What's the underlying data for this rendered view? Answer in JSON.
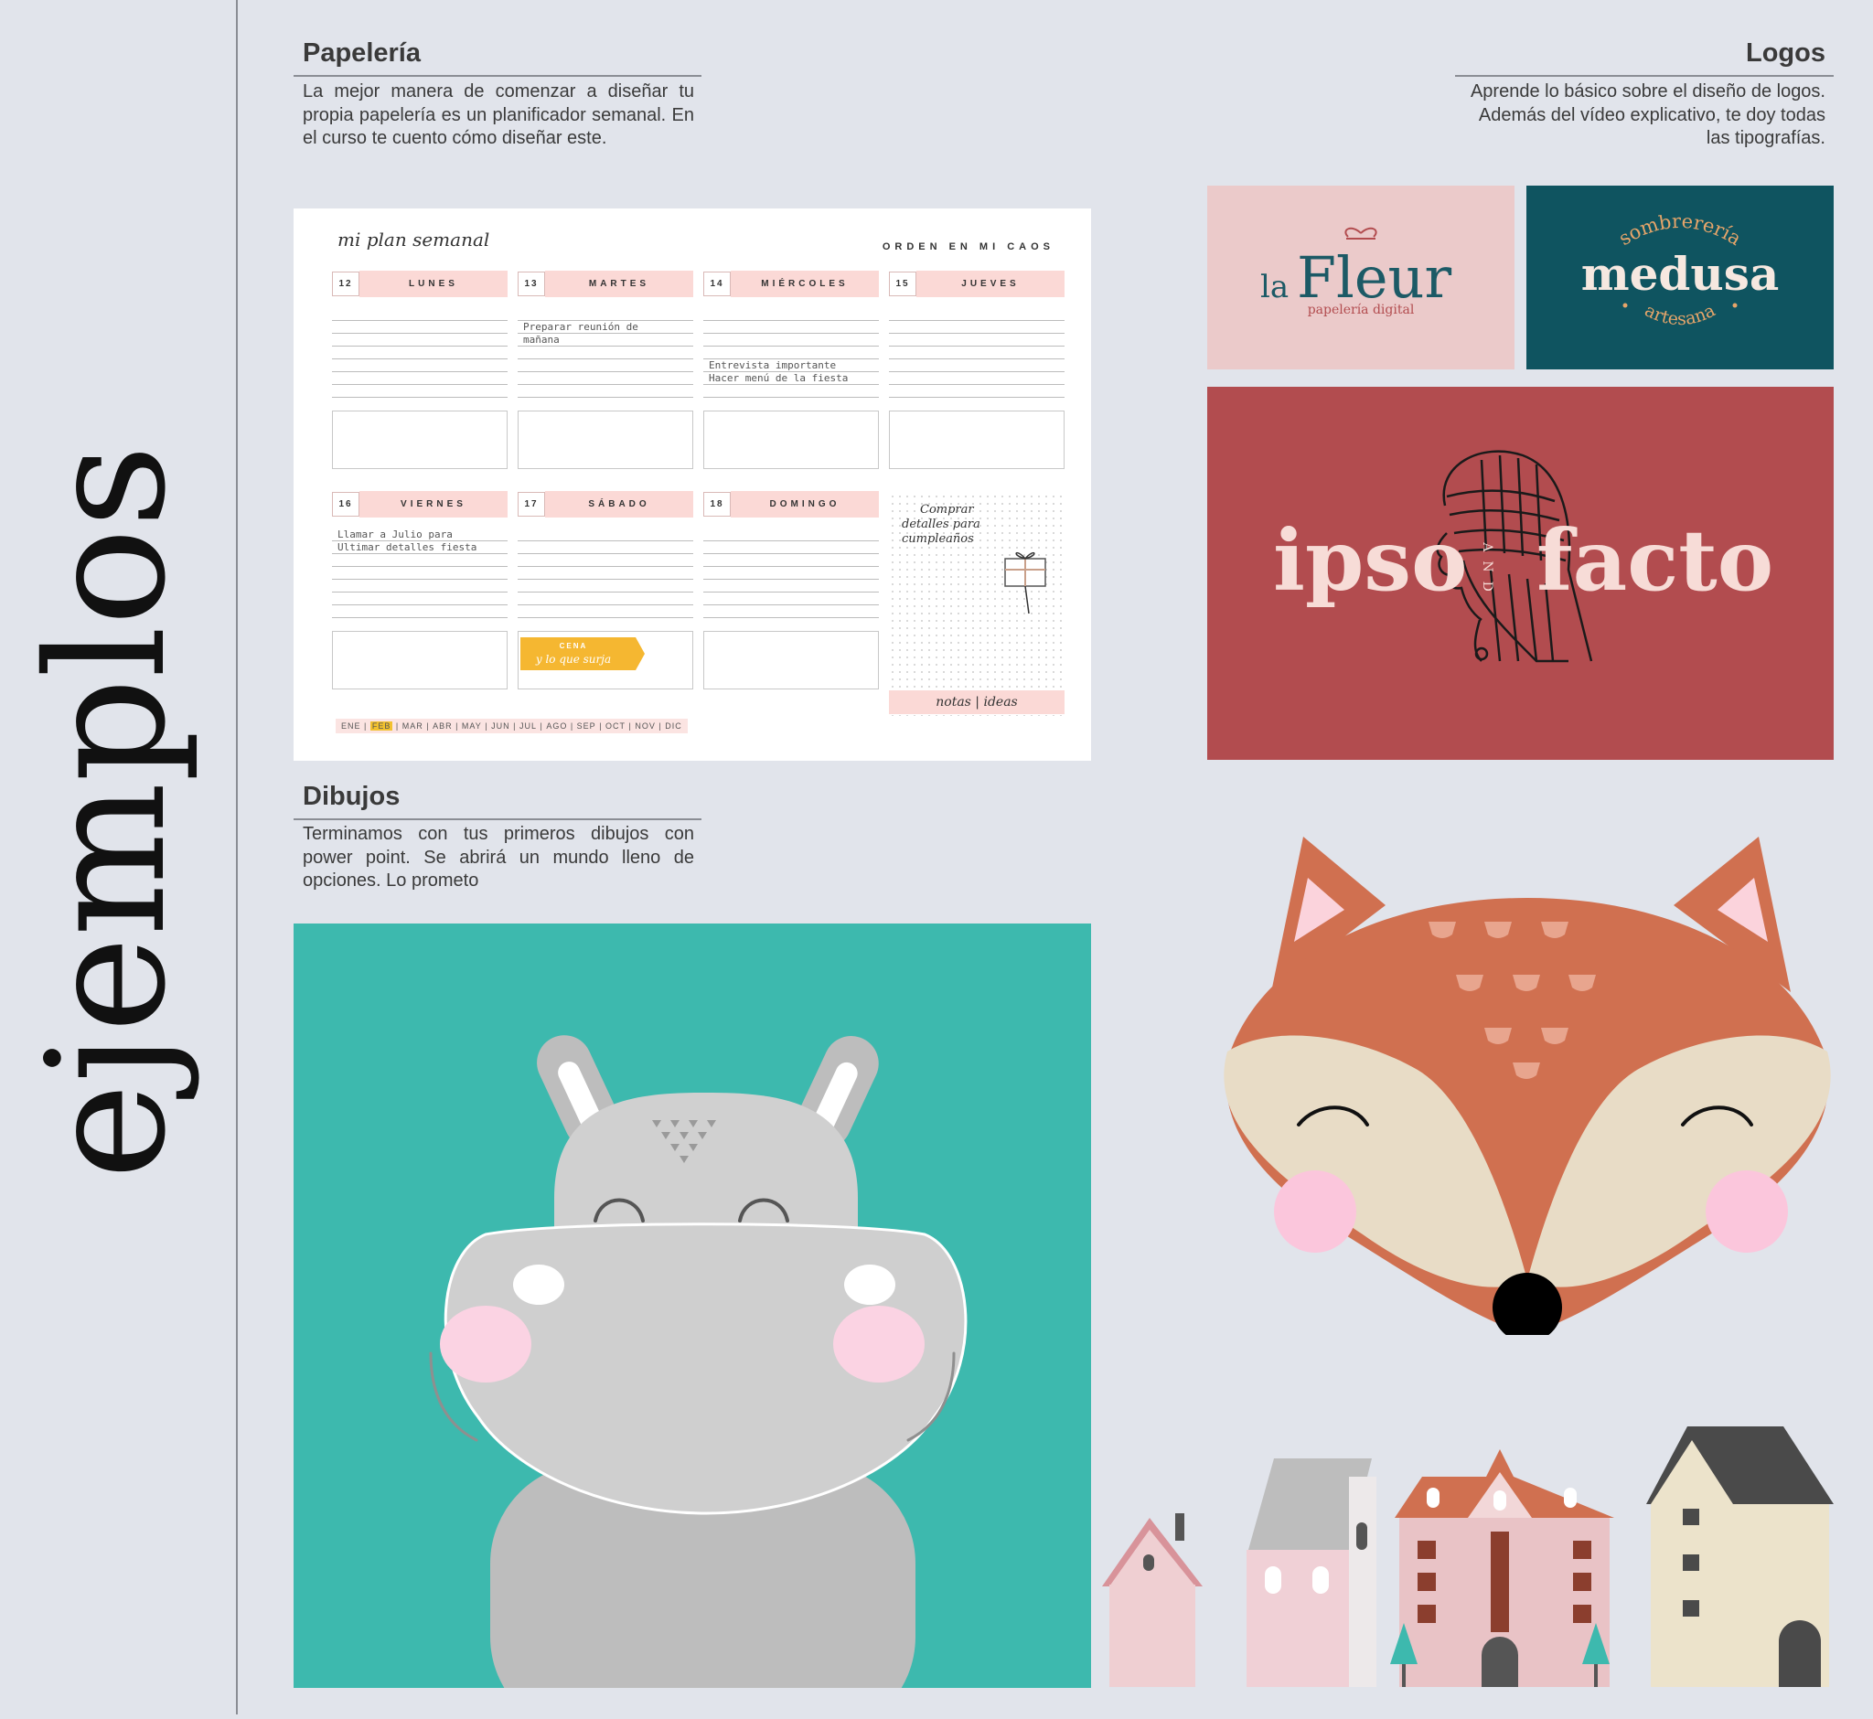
{
  "sidebar": {
    "title": "ejemplos"
  },
  "papeleria": {
    "title": "Papelería",
    "text": "La mejor manera de comenzar a diseñar tu propia papelería es un planificador semanal. En el curso te cuento cómo diseñar este."
  },
  "logos": {
    "title": "Logos",
    "text": "Aprende lo básico sobre el diseño de logos. Además del vídeo explicativo, te doy todas las tipografías."
  },
  "dibujos": {
    "title": "Dibujos",
    "text": "Terminamos con tus primeros dibujos con power point. Se abrirá un mundo lleno de opciones. Lo prometo"
  },
  "planner": {
    "title": "mi plan semanal",
    "brand": "ORDEN EN MI CAOS",
    "days": [
      {
        "num": "12",
        "name": "LUNES"
      },
      {
        "num": "13",
        "name": "MARTES"
      },
      {
        "num": "14",
        "name": "MIÉRCOLES"
      },
      {
        "num": "15",
        "name": "JUEVES"
      },
      {
        "num": "16",
        "name": "VIERNES"
      },
      {
        "num": "17",
        "name": "SÁBADO"
      },
      {
        "num": "18",
        "name": "DOMINGO"
      }
    ],
    "notes": {
      "martes_1": "Preparar reunión de",
      "martes_2": "mañana",
      "miercoles_1": "Entrevista importante",
      "miercoles_2": "Hacer menú de la fiesta",
      "viernes_1": "Llamar a Julio para",
      "viernes_2": "Ultimar detalles fiesta"
    },
    "sticky_note": {
      "line1": "Comprar",
      "line2": "detalles para",
      "line3": "cumpleaños"
    },
    "ribbon": {
      "line1": "CENA",
      "line2": "y lo que surja"
    },
    "notas_label": "notas | ideas",
    "months": [
      "ENE",
      "FEB",
      "MAR",
      "ABR",
      "MAY",
      "JUN",
      "JUL",
      "AGO",
      "SEP",
      "OCT",
      "NOV",
      "DIC"
    ],
    "selected_month": "FEB"
  },
  "logo_lafleur": {
    "la": "la",
    "fleur": "Fleur",
    "tagline": "papelería digital"
  },
  "logo_medusa": {
    "top": "sombrerería",
    "name": "medusa",
    "bottom": "artesana"
  },
  "logo_ipso": {
    "left": "ipso",
    "right": "facto",
    "and": "AND"
  },
  "colors": {
    "background": "#e1e4eb",
    "lafleur_bg": "#ebcaca",
    "medusa_bg": "#0f5460",
    "ipso_bg": "#b24c4f",
    "hippo_bg": "#3db9ae",
    "fox": "#d07050",
    "planner_pink": "#fbd9d6"
  }
}
